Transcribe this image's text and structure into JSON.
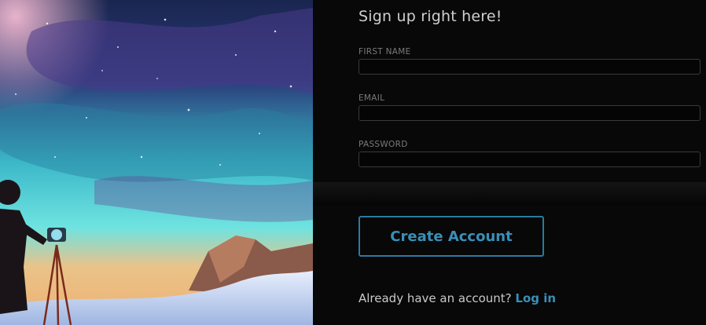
{
  "form": {
    "title": "Sign up right here!",
    "fields": [
      {
        "label": "FIRST NAME",
        "value": "",
        "placeholder": ""
      },
      {
        "label": "EMAIL",
        "value": "",
        "placeholder": ""
      },
      {
        "label": "PASSWORD",
        "value": "",
        "placeholder": ""
      }
    ],
    "submit_label": "Create Account",
    "login_prompt": "Already have an account?",
    "login_link": "Log in"
  },
  "colors": {
    "accent": "#3a8fb8",
    "background": "#080808"
  }
}
